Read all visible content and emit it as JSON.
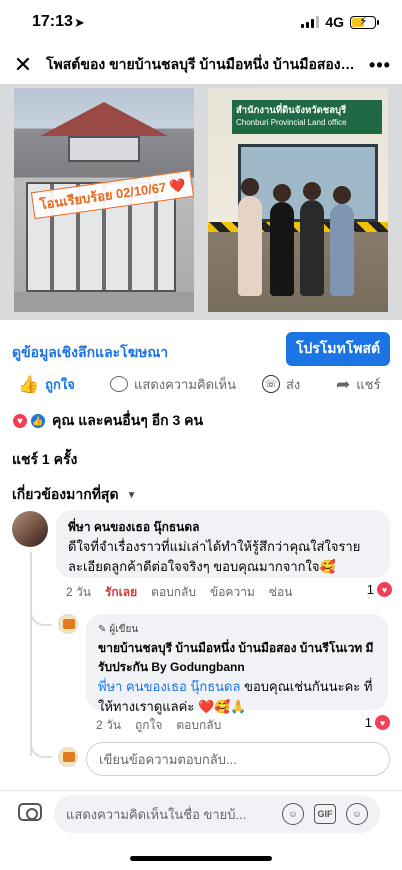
{
  "status_bar": {
    "time": "17:13",
    "network": "4G"
  },
  "header": {
    "title": "โพสต์ของ ขายบ้านชลบุรี บ้านมือหนึ่ง บ้านมือสอง บ้านรี..."
  },
  "photos": {
    "photo1_label": "โอนเรียบร้อย 02/10/67 ❤️",
    "photo2_sign_line1": "สำนักงานที่ดินจังหวัดชลบุรี",
    "photo2_sign_line2": "Chonburi Provincial Land office"
  },
  "promo": {
    "insights_label": "ดูข้อมูลเชิงลึกและโฆษณา",
    "promote_button": "โปรโมทโพสต์"
  },
  "actions": {
    "like": "ถูกใจ",
    "comment": "แสดงความคิดเห็น",
    "send": "ส่ง",
    "share": "แชร์"
  },
  "reactions": {
    "summary": "คุณ และคนอื่นๆ อีก 3 คน"
  },
  "shares": {
    "label": "แชร์ 1 ครั้ง"
  },
  "sort": {
    "label": "เกี่ยวข้องมากที่สุด"
  },
  "comments": [
    {
      "author": "พี่ษา คนของเธอ นุ๊กธนดล",
      "text": "ดีใจที่จำเรื่องราวที่แม่เล่าได้ทำให้รู้สึกว่าคุณใส่ใจราย ละเอียดลูกค้าดีต่อใจจริงๆ ขอบคุณมากจากใจ🥰",
      "time": "2 วัน",
      "reaction": "รักเลย",
      "reply": "ตอบกลับ",
      "message": "ข้อความ",
      "hide": "ซ่อน",
      "count": "1"
    }
  ],
  "reply": {
    "badge": "ผู้เขียน",
    "author": "ขายบ้านชลบุรี บ้านมือหนึ่ง บ้านมือสอง บ้านรีโนเวท มีรับประกัน By Godungbann",
    "tag": "พี่ษา คนของเธอ นุ๊กธนดล",
    "text": " ขอบคุณเช่นกันนะคะ ที่ให้ทางเราดูแลค่ะ ❤️🥰🙏",
    "time": "2 วัน",
    "like": "ถูกใจ",
    "reply": "ตอบกลับ",
    "count": "1"
  },
  "reply_input": {
    "placeholder": "เขียนข้อความตอบกลับ..."
  },
  "composer": {
    "placeholder": "แสดงความคิดเห็นในชื่อ ขายบ้...",
    "gif": "GIF"
  },
  "colors": {
    "accent": "#1b74e4",
    "love": "#f33e58"
  }
}
